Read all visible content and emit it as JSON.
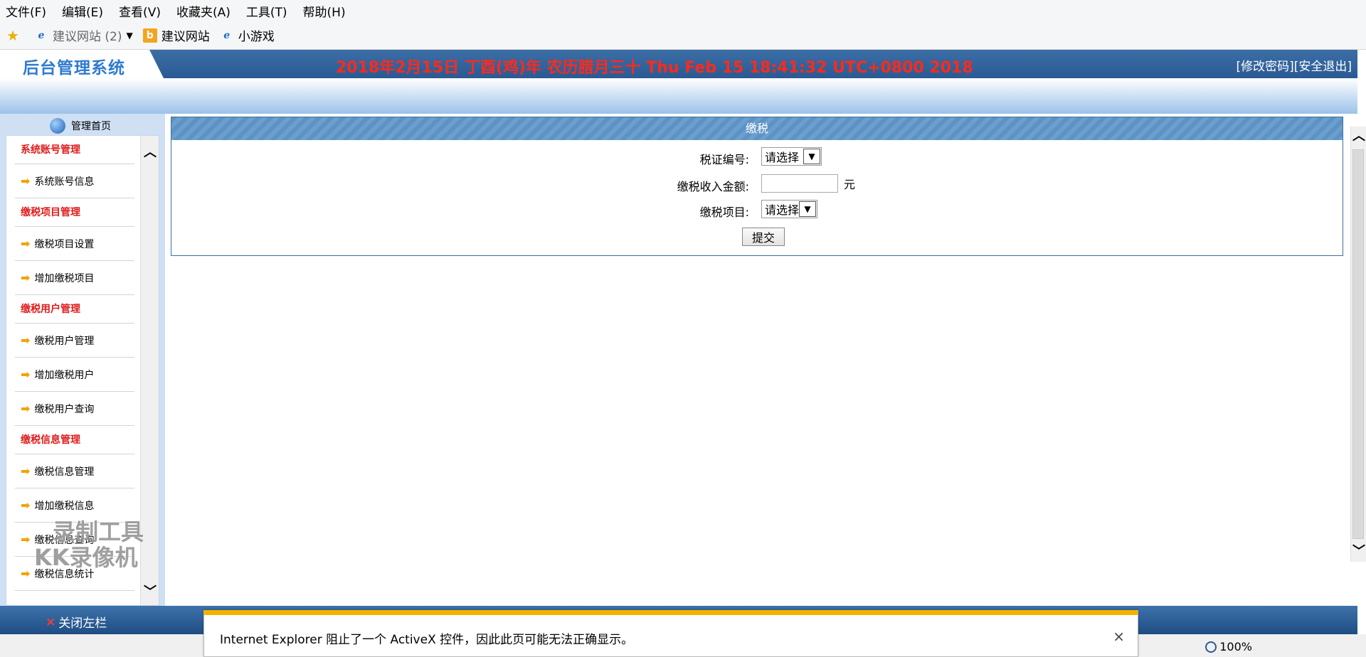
{
  "browser": {
    "menu": [
      "文件(F)",
      "编辑(E)",
      "查看(V)",
      "收藏夹(A)",
      "工具(T)",
      "帮助(H)"
    ],
    "favorites": [
      {
        "label": "建议网站 (2)",
        "icon": "ie-icon",
        "dropdown": true
      },
      {
        "label": "建议网站",
        "icon": "bing-icon"
      },
      {
        "label": "小游戏",
        "icon": "ie-icon"
      }
    ],
    "zoom": "100%"
  },
  "header": {
    "title": "后台管理系统",
    "datetime": "2018年2月15日  丁酉(鸡)年  农历腊月三十  Thu Feb 15 18:41:32 UTC+0800 2018",
    "change_password": "[修改密码]",
    "logout": "[安全退出]"
  },
  "sidebar": {
    "home": "管理首页",
    "groups": [
      {
        "category": "系统账号管理",
        "items": [
          "系统账号信息"
        ]
      },
      {
        "category": "缴税项目管理",
        "items": [
          "缴税项目设置",
          "增加缴税项目"
        ]
      },
      {
        "category": "缴税用户管理",
        "items": [
          "缴税用户管理",
          "增加缴税用户",
          "缴税用户查询"
        ]
      },
      {
        "category": "缴税信息管理",
        "items": [
          "缴税信息管理",
          "增加缴税信息",
          "缴税信息查询",
          "缴税信息统计"
        ]
      }
    ],
    "close_label": "关闭左栏"
  },
  "form": {
    "title": "缴税",
    "tax_cert_label": "税证编号:",
    "tax_cert_value": "请选择",
    "amount_label": "缴税收入金额:",
    "amount_value": "",
    "amount_unit": "元",
    "project_label": "缴税项目:",
    "project_value": "请选择",
    "submit": "提交"
  },
  "notification": {
    "message": "Internet Explorer 阻止了一个 ActiveX 控件，因此此页可能无法正确显示。"
  },
  "watermark": {
    "line1": "录制工具",
    "line2": "KK录像机"
  },
  "colors": {
    "header_blue": "#2a5a93",
    "datetime_red": "#ff2a1a",
    "category_red": "#e01c1c",
    "notify_yellow": "#f2b200"
  }
}
